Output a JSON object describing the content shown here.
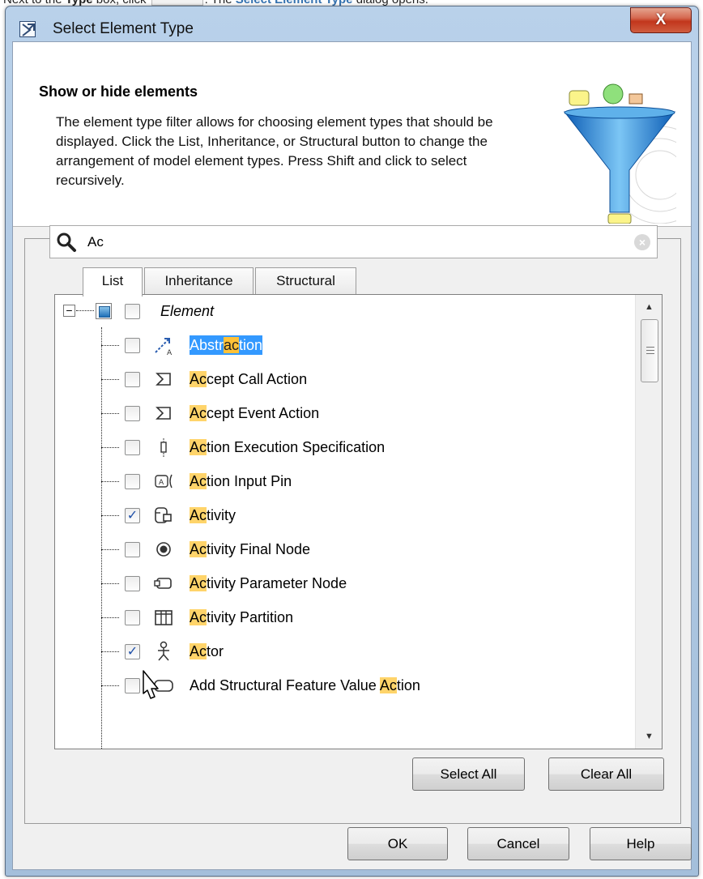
{
  "caption": {
    "prefix": "Next to the ",
    "type_word": "Type",
    "mid": " box, click ",
    "after_btn": ". The ",
    "dialog_link": "Select Element Type",
    "suffix": " dialog opens."
  },
  "window": {
    "title": "Select Element Type",
    "close_glyph": "X"
  },
  "header": {
    "title": "Show or hide elements",
    "description": "The element type filter allows for choosing element types that should be displayed. Click the List, Inheritance, or Structural button to change the arrangement of model element types. Press Shift and click to select recursively."
  },
  "search": {
    "value": "Ac",
    "clear_glyph": "×"
  },
  "tabs": [
    {
      "label": "List",
      "active": true
    },
    {
      "label": "Inheritance",
      "active": false
    },
    {
      "label": "Structural",
      "active": false
    }
  ],
  "tree": {
    "root": {
      "label": "Element",
      "expander": "−"
    },
    "items": [
      {
        "pre": "Abstr",
        "hl": "ac",
        "post": "tion",
        "checked": false,
        "selected": true,
        "icon": "abstraction-icon"
      },
      {
        "pre": "",
        "hl": "Ac",
        "post": "cept Call Action",
        "checked": false,
        "selected": false,
        "icon": "accept-call-action-icon"
      },
      {
        "pre": "",
        "hl": "Ac",
        "post": "cept Event Action",
        "checked": false,
        "selected": false,
        "icon": "accept-event-action-icon"
      },
      {
        "pre": "",
        "hl": "Ac",
        "post": "tion Execution Specification",
        "checked": false,
        "selected": false,
        "icon": "action-execution-specification-icon"
      },
      {
        "pre": "",
        "hl": "Ac",
        "post": "tion Input Pin",
        "checked": false,
        "selected": false,
        "icon": "action-input-pin-icon"
      },
      {
        "pre": "",
        "hl": "Ac",
        "post": "tivity",
        "checked": true,
        "selected": false,
        "icon": "activity-icon"
      },
      {
        "pre": "",
        "hl": "Ac",
        "post": "tivity Final Node",
        "checked": false,
        "selected": false,
        "icon": "activity-final-node-icon"
      },
      {
        "pre": "",
        "hl": "Ac",
        "post": "tivity Parameter Node",
        "checked": false,
        "selected": false,
        "icon": "activity-parameter-node-icon"
      },
      {
        "pre": "",
        "hl": "Ac",
        "post": "tivity Partition",
        "checked": false,
        "selected": false,
        "icon": "activity-partition-icon"
      },
      {
        "pre": "",
        "hl": "Ac",
        "post": "tor",
        "checked": true,
        "selected": false,
        "icon": "actor-icon"
      },
      {
        "pre": "Add Structural Feature Value ",
        "hl": "Ac",
        "post": "tion",
        "checked": false,
        "selected": false,
        "icon": "add-structural-feature-value-action-icon"
      }
    ]
  },
  "buttons": {
    "select_all": "Select All",
    "clear_all": "Clear All",
    "ok": "OK",
    "cancel": "Cancel",
    "help": "Help"
  },
  "colors": {
    "selection": "#3399ff",
    "match_highlight": "#ffd46a",
    "title_bar": "#b9d1ea",
    "close_button": "#c2361c"
  },
  "scrollbar": {
    "position_fraction": 0.05
  }
}
